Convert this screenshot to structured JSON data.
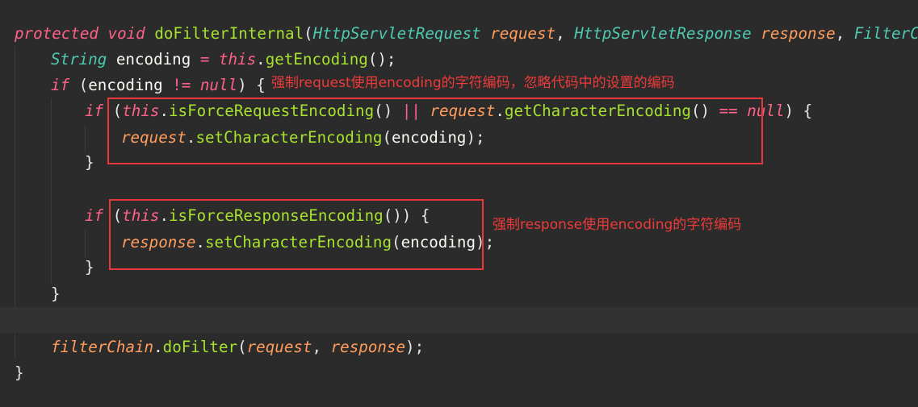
{
  "code": {
    "l1": {
      "mod": "protected",
      "ret": "void",
      "method": "doFilterInternal",
      "open": "(",
      "t1": "HttpServletRequest",
      "p1": "request",
      "c1": ", ",
      "t2": "HttpServletResponse",
      "p2": "response",
      "c2": ", ",
      "t3": "FilterChain"
    },
    "l2": {
      "type": "String",
      "var": "encoding",
      "eq": " = ",
      "this": "this",
      "dot": ".",
      "call": "getEncoding",
      "end": "();"
    },
    "l3": {
      "if": "if",
      "open": " (",
      "var": "encoding",
      "op": " != ",
      "null": "null",
      "close": ") {"
    },
    "l4": {
      "if": "if",
      "open": " (",
      "this": "this",
      "dot": ".",
      "call1": "isForceRequestEncoding",
      "paren1": "() ",
      "or": "||",
      "sp": " ",
      "req": "request",
      "dot2": ".",
      "call2": "getCharacterEncoding",
      "paren2": "() ",
      "eqeq": "==",
      "sp2": " ",
      "null": "null",
      "close": ") {"
    },
    "l5": {
      "req": "request",
      "dot": ".",
      "call": "setCharacterEncoding",
      "open": "(",
      "arg": "encoding",
      "end": ");"
    },
    "l6": "}",
    "l8": {
      "if": "if",
      "open": " (",
      "this": "this",
      "dot": ".",
      "call": "isForceResponseEncoding",
      "close": "()) {"
    },
    "l9": {
      "resp": "response",
      "dot": ".",
      "call": "setCharacterEncoding",
      "open": "(",
      "arg": "encoding",
      "end": ");"
    },
    "l10": "}",
    "l11": "}",
    "l13": {
      "chain": "filterChain",
      "dot": ".",
      "call": "doFilter",
      "open": "(",
      "a1": "request",
      "comma": ", ",
      "a2": "response",
      "end": ");"
    },
    "l14": "}"
  },
  "annotations": {
    "request_note": "强制request使用encoding的字符编码，忽略代码中的设置的编码",
    "response_note": "强制response使用encoding的字符编码"
  },
  "colors": {
    "background": "#2b2b2b",
    "annotation_red": "#e8383c"
  }
}
